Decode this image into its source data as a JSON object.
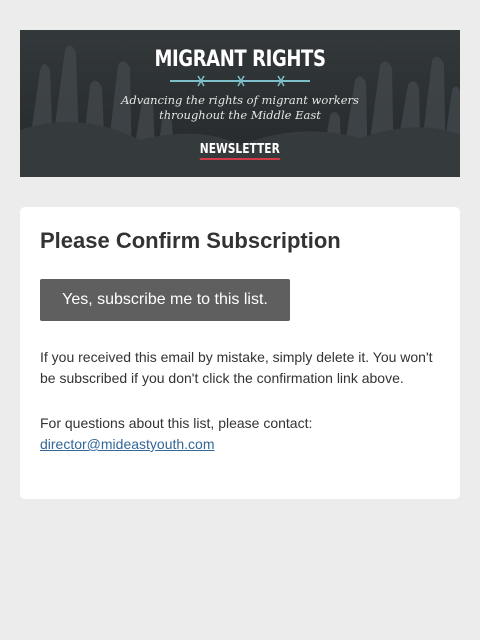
{
  "banner": {
    "title": "MIGRANT RIGHTS",
    "tagline_line1": "Advancing the rights of migrant workers",
    "tagline_line2": "throughout the Middle East",
    "newsletter_label": "NEWSLETTER",
    "accent_color": "#d33a45",
    "wire_color": "#7ec0c9",
    "background_color": "#2a2e31"
  },
  "card": {
    "title": "Please Confirm Subscription",
    "confirm_button_label": "Yes, subscribe me to this list.",
    "mistake_text": "If you received this email by mistake, simply delete it. You won't be subscribed if you don't click the confirmation link above.",
    "contact_prefix": "For questions about this list, please contact:",
    "contact_email": "director@mideastyouth.com",
    "button_color": "#5f5f5f",
    "link_color": "#336699"
  },
  "page": {
    "background_color": "#ececec"
  }
}
